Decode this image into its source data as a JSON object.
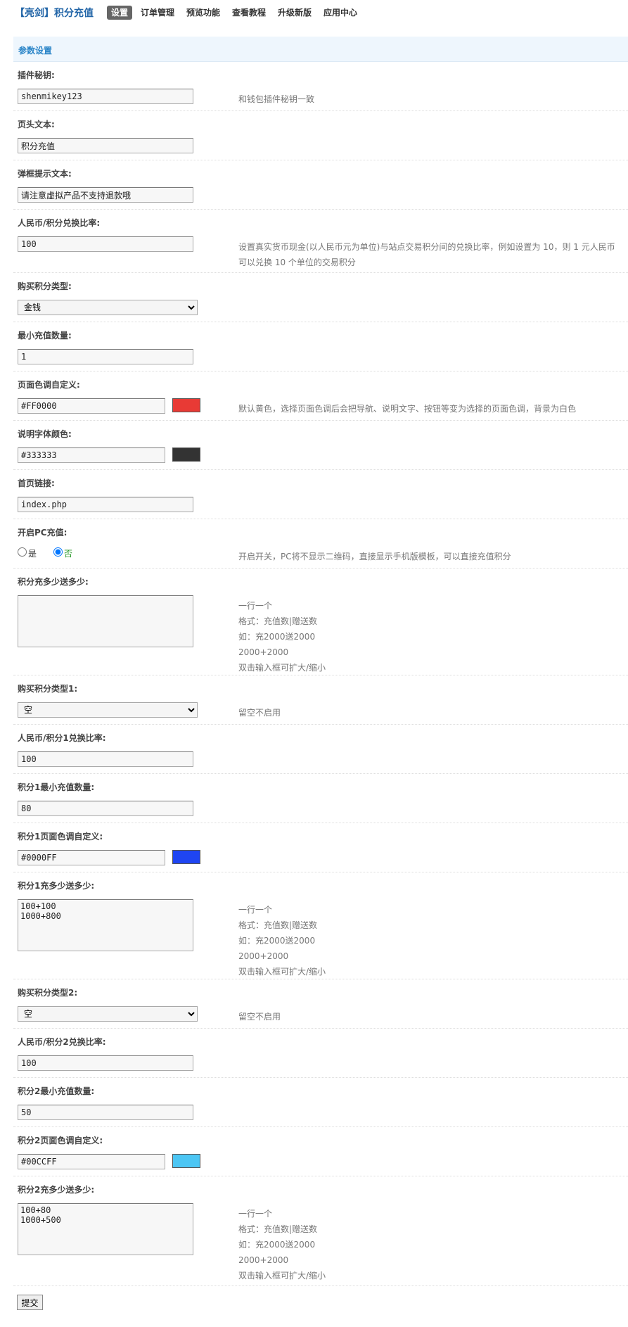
{
  "brand": "【亮剑】积分充值",
  "nav": [
    "设置",
    "订单管理",
    "预览功能",
    "查看教程",
    "升级新版",
    "应用中心"
  ],
  "section_title": "参数设置",
  "fields": {
    "plugin_key": {
      "label": "插件秘钥:",
      "value": "shenmikey123",
      "hint": "和钱包插件秘钥一致"
    },
    "header_text": {
      "label": "页头文本:",
      "value": "积分充值"
    },
    "popup_text": {
      "label": "弹框提示文本:",
      "value": "请注意虚拟产品不支持退款哦"
    },
    "rmb_ratio": {
      "label": "人民币/积分兑换比率:",
      "value": "100",
      "hint": "设置真实货币现金(以人民币元为单位)与站点交易积分间的兑换比率，例如设置为 10，则 1 元人民币可以兑换 10 个单位的交易积分"
    },
    "credit_type": {
      "label": "购买积分类型:",
      "value": "金钱"
    },
    "min_amount": {
      "label": "最小充值数量:",
      "value": "1"
    },
    "page_color": {
      "label": "页面色调自定义:",
      "value": "#FF0000",
      "swatch": "#e83a35",
      "hint": "默认黄色，选择页面色调后会把导航、说明文字、按钮等变为选择的页面色调，背景为白色"
    },
    "text_color": {
      "label": "说明字体颜色:",
      "value": "#333333",
      "swatch": "#333333"
    },
    "home_link": {
      "label": "首页链接:",
      "value": "index.php"
    },
    "pc_recharge": {
      "label": "开启PC充值:",
      "opt_yes": "是",
      "opt_no": "否",
      "hint": "开启开关，PC将不显示二维码，直接显示手机版模板，可以直接充值积分"
    },
    "bonus": {
      "label": "积分充多少送多少:",
      "value": "",
      "hint": [
        "一行一个",
        "格式：充值数|赠送数",
        "如：充2000送2000",
        "2000+2000",
        "双击输入框可扩大/缩小"
      ]
    },
    "credit_type1": {
      "label": "购买积分类型1:",
      "value": "空",
      "hint": "留空不启用"
    },
    "rmb_ratio1": {
      "label": "人民币/积分1兑换比率:",
      "value": "100"
    },
    "min_amount1": {
      "label": "积分1最小充值数量:",
      "value": "80"
    },
    "page_color1": {
      "label": "积分1页面色调自定义:",
      "value": "#0000FF",
      "swatch": "#1f45f2"
    },
    "bonus1": {
      "label": "积分1充多少送多少:",
      "value": "100+100\n1000+800",
      "hint": [
        "一行一个",
        "格式：充值数|赠送数",
        "如：充2000送2000",
        "2000+2000",
        "双击输入框可扩大/缩小"
      ]
    },
    "credit_type2": {
      "label": "购买积分类型2:",
      "value": "空",
      "hint": "留空不启用"
    },
    "rmb_ratio2": {
      "label": "人民币/积分2兑换比率:",
      "value": "100"
    },
    "min_amount2": {
      "label": "积分2最小充值数量:",
      "value": "50"
    },
    "page_color2": {
      "label": "积分2页面色调自定义:",
      "value": "#00CCFF",
      "swatch": "#4cc6f4"
    },
    "bonus2": {
      "label": "积分2充多少送多少:",
      "value": "100+80\n1000+500",
      "hint": [
        "一行一个",
        "格式：充值数|赠送数",
        "如：充2000送2000",
        "2000+2000",
        "双击输入框可扩大/缩小"
      ]
    }
  },
  "submit_label": "提交"
}
